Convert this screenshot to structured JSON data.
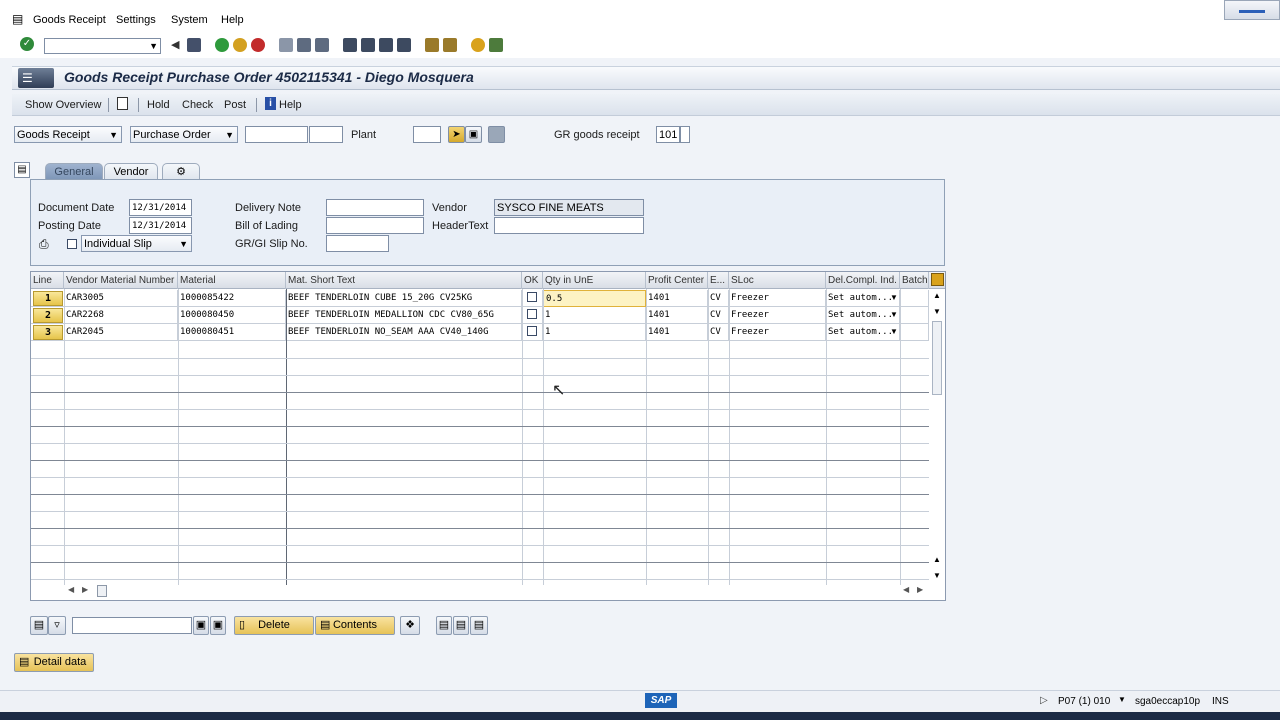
{
  "menu": {
    "items": [
      "Goods Receipt",
      "Settings",
      "System",
      "Help"
    ]
  },
  "page_title": "Goods Receipt Purchase Order 4502115341 - Diego Mosquera",
  "app_toolbar": {
    "show_overview": "Show Overview",
    "hold": "Hold",
    "check": "Check",
    "post": "Post",
    "help": "Help"
  },
  "selection": {
    "transaction": "Goods Receipt",
    "reference": "Purchase Order",
    "plant_label": "Plant",
    "gr_label": "GR goods receipt",
    "movement_type": "101"
  },
  "tabs": [
    "General",
    "Vendor",
    "⚙"
  ],
  "header": {
    "document_date_label": "Document Date",
    "document_date": "12/31/2014",
    "posting_date_label": "Posting Date",
    "posting_date": "12/31/2014",
    "slip_type": "Individual Slip",
    "delivery_note_label": "Delivery Note",
    "bill_of_lading_label": "Bill of Lading",
    "gr_gi_slip_label": "GR/GI Slip No.",
    "vendor_label": "Vendor",
    "vendor": "SYSCO FINE MEATS",
    "header_text_label": "HeaderText"
  },
  "grid": {
    "columns": [
      "Line",
      "Vendor Material Number",
      "Material",
      "Mat. Short Text",
      "OK",
      "Qty in UnE",
      "Profit Center",
      "E...",
      "SLoc",
      "Del.Compl. Ind.",
      "Batch"
    ],
    "rows": [
      {
        "line": "1",
        "vendor_mat": "CAR3005",
        "material": "1000085422",
        "text": "BEEF TENDERLOIN CUBE 15_20G CV25KG",
        "qty": "0.5",
        "profit_center": "1401",
        "e": "CV",
        "sloc": "Freezer",
        "del": "Set autom..."
      },
      {
        "line": "2",
        "vendor_mat": "CAR2268",
        "material": "1000080450",
        "text": "BEEF TENDERLOIN MEDALLION CDC CV80_65G",
        "qty": "1",
        "profit_center": "1401",
        "e": "CV",
        "sloc": "Freezer",
        "del": "Set autom..."
      },
      {
        "line": "3",
        "vendor_mat": "CAR2045",
        "material": "1000080451",
        "text": "BEEF TENDERLOIN NO_SEAM AAA CV40_140G",
        "qty": "1",
        "profit_center": "1401",
        "e": "CV",
        "sloc": "Freezer",
        "del": "Set autom..."
      }
    ]
  },
  "footer": {
    "delete": "Delete",
    "contents": "Contents",
    "detail_data": "Detail data"
  },
  "status": {
    "sap": "SAP",
    "system": "P07 (1) 010",
    "server": "sga0eccap10p",
    "mode": "INS"
  },
  "colors": {
    "accent": "#2b5fb8",
    "button_yellow": "#e6c44b",
    "panel": "#e9eff7"
  }
}
